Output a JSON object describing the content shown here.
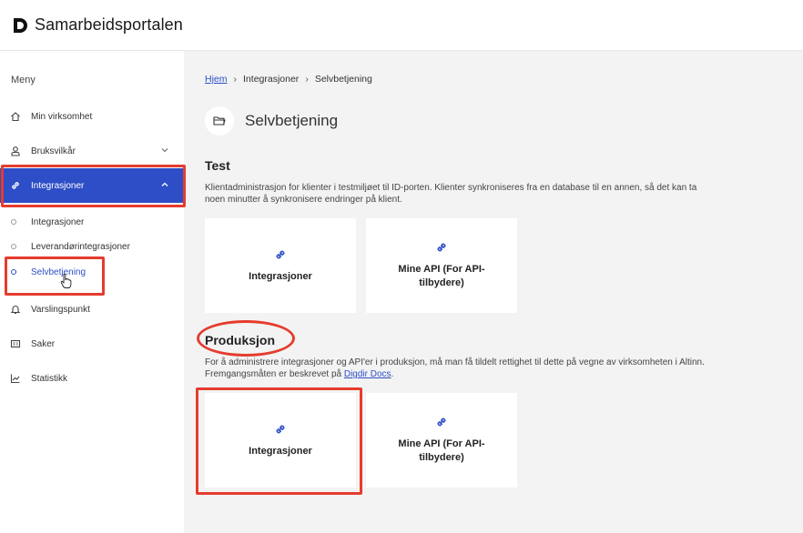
{
  "app": {
    "brand": "Samarbeidsportalen"
  },
  "sidebar": {
    "menu_title": "Meny",
    "items": [
      {
        "label": "Min virksomhet",
        "icon": "home-icon"
      },
      {
        "label": "Bruksvilkår",
        "icon": "user-icon"
      },
      {
        "label": "Integrasjoner",
        "icon": "link-icon"
      },
      {
        "label": "Varslingspunkt",
        "icon": "bell-icon"
      },
      {
        "label": "Saker",
        "icon": "cases-icon"
      },
      {
        "label": "Statistikk",
        "icon": "chart-icon"
      }
    ],
    "subitems": [
      {
        "label": "Integrasjoner"
      },
      {
        "label": "Leverandørintegrasjoner"
      },
      {
        "label": "Selvbetjening"
      }
    ]
  },
  "breadcrumb": {
    "home": "Hjem",
    "level1": "Integrasjoner",
    "current": "Selvbetjening",
    "separator": "›"
  },
  "page": {
    "title": "Selvbetjening",
    "icon": "folder-icon"
  },
  "sections": {
    "test": {
      "title": "Test",
      "description": "Klientadministrasjon for klienter i testmiljøet til ID-porten. Klienter synkroniseres fra en database til en annen, så det kan ta noen minutter å synkronisere endringer på klient.",
      "cards": [
        {
          "label": "Integrasjoner",
          "icon": "link-icon"
        },
        {
          "label": "Mine API (For API-tilbydere)",
          "icon": "link-icon"
        }
      ]
    },
    "produksjon": {
      "title": "Produksjon",
      "description": "For å administrere integrasjoner og API'er i produksjon, må man få tildelt rettighet til dette på vegne av virksomheten i Altinn. Fremgangsmåten er beskrevet på",
      "link": "Digdir Docs",
      "link_suffix": ".",
      "cards": [
        {
          "label": "Integrasjoner",
          "icon": "link-icon"
        },
        {
          "label": "Mine API (For API-tilbydere)",
          "icon": "link-icon"
        }
      ]
    }
  },
  "colors": {
    "accent": "#2d4ec6",
    "highlight": "#e53c2e"
  }
}
